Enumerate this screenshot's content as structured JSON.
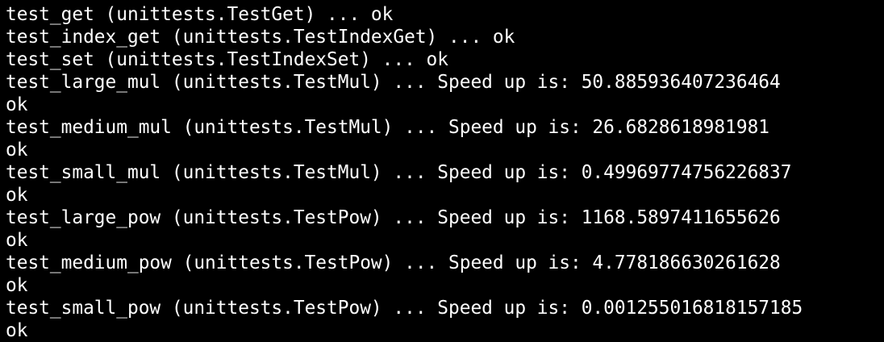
{
  "terminal": {
    "background": "#000000",
    "text_color": "#ffffff",
    "lines": [
      "test_get (unittests.TestGet) ... ok",
      "test_index_get (unittests.TestIndexGet) ... ok",
      "test_set (unittests.TestIndexSet) ... ok",
      "test_large_mul (unittests.TestMul) ... Speed up is: 50.885936407236464",
      "ok",
      "test_medium_mul (unittests.TestMul) ... Speed up is: 26.6828618981981",
      "ok",
      "test_small_mul (unittests.TestMul) ... Speed up is: 0.49969774756226837",
      "ok",
      "test_large_pow (unittests.TestPow) ... Speed up is: 1168.5897411655626",
      "ok",
      "test_medium_pow (unittests.TestPow) ... Speed up is: 4.778186630261628",
      "ok",
      "test_small_pow (unittests.TestPow) ... Speed up is: 0.001255016818157185",
      "ok"
    ]
  }
}
